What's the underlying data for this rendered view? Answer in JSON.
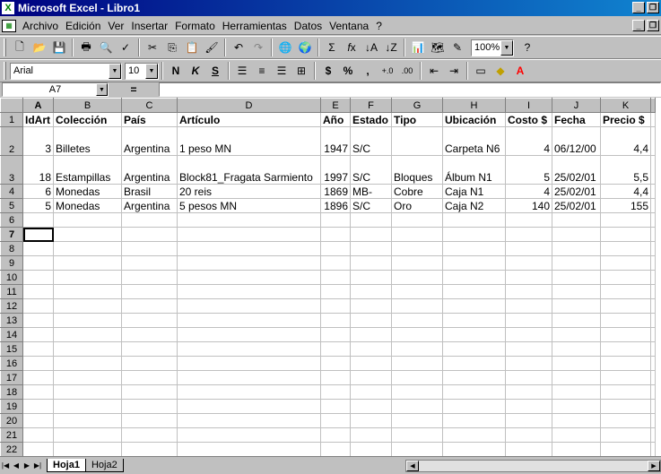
{
  "window": {
    "title": "Microsoft Excel - Libro1"
  },
  "menu": [
    "Archivo",
    "Edición",
    "Ver",
    "Insertar",
    "Formato",
    "Herramientas",
    "Datos",
    "Ventana",
    "?"
  ],
  "toolbar": {
    "zoom": "100%",
    "font": "Arial",
    "size": "10",
    "currency": "$",
    "percent": "%"
  },
  "formula": {
    "cell_ref": "A7",
    "equals": "="
  },
  "grid": {
    "columns": [
      "A",
      "B",
      "C",
      "D",
      "E",
      "F",
      "G",
      "H",
      "I",
      "J",
      "K"
    ],
    "header_row": [
      "IdArt",
      "Colección",
      "País",
      "Artículo",
      "Año",
      "Estado",
      "Tipo",
      "Ubicación",
      "Costo $",
      "Fecha",
      "Precio $"
    ],
    "rows": [
      [
        "3",
        "Billetes",
        "Argentina",
        "1 peso MN",
        "1947",
        "S/C",
        "",
        "Carpeta N6",
        "4",
        "06/12/00",
        "4,4"
      ],
      [
        "18",
        "Estampillas",
        "Argentina",
        "Block81_Fragata Sarmiento",
        "1997",
        "S/C",
        "Bloques",
        "Álbum N1",
        "5",
        "25/02/01",
        "5,5"
      ],
      [
        "6",
        "Monedas",
        "Brasil",
        "20 reis",
        "1869",
        "MB-",
        "Cobre",
        "Caja N1",
        "4",
        "25/02/01",
        "4,4"
      ],
      [
        "5",
        "Monedas",
        "Argentina",
        "5 pesos MN",
        "1896",
        "S/C",
        "Oro",
        "Caja N2",
        "140",
        "25/02/01",
        "155"
      ]
    ]
  },
  "sheets": [
    "Hoja1",
    "Hoja2"
  ]
}
